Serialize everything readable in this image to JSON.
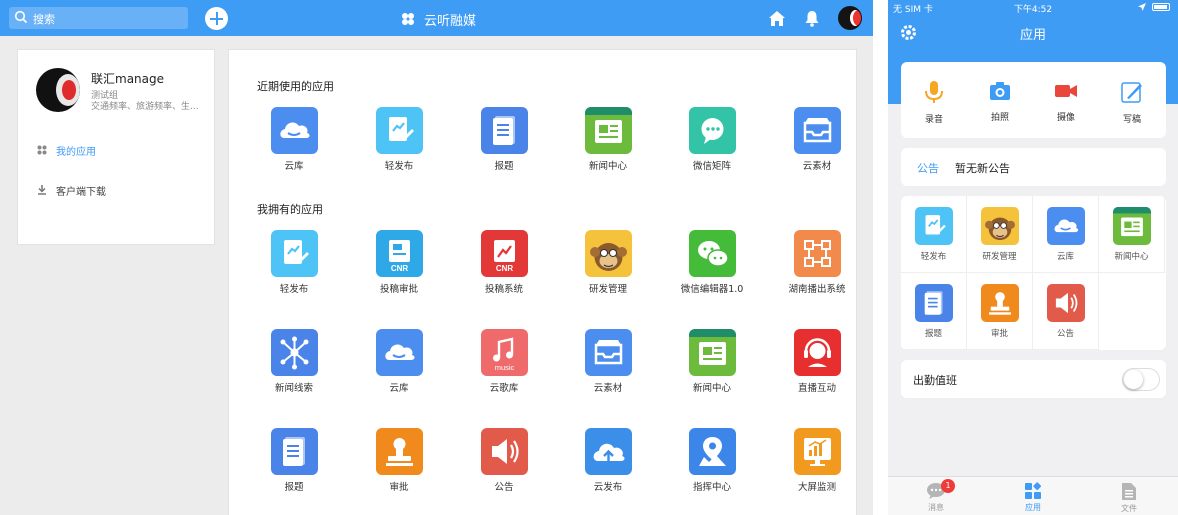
{
  "web": {
    "search_placeholder": "搜索",
    "brand_title": "云听融媒",
    "profile": {
      "name": "联汇manage",
      "group": "测试组",
      "description": "交通频率、旅游频率、生..."
    },
    "sidebar": [
      {
        "label": "我的应用",
        "icon": "apps-icon",
        "active": true
      },
      {
        "label": "客户端下载",
        "icon": "download-icon",
        "active": false
      }
    ],
    "recent_title": "近期使用的应用",
    "recent_apps": [
      {
        "label": "云库",
        "icon": "cloud-library-icon"
      },
      {
        "label": "轻发布",
        "icon": "quick-publish-icon"
      },
      {
        "label": "报题",
        "icon": "report-topic-icon"
      },
      {
        "label": "新闻中心",
        "icon": "news-center-icon"
      },
      {
        "label": "微信矩阵",
        "icon": "wechat-matrix-icon"
      },
      {
        "label": "云素材",
        "icon": "cloud-material-icon"
      }
    ],
    "owned_title": "我拥有的应用",
    "owned_apps": [
      {
        "label": "轻发布",
        "icon": "quick-publish-icon"
      },
      {
        "label": "投稿审批",
        "icon": "submission-review-icon",
        "badge": "CNR"
      },
      {
        "label": "投稿系统",
        "icon": "submission-system-icon",
        "badge": "CNR"
      },
      {
        "label": "研发管理",
        "icon": "rd-management-icon"
      },
      {
        "label": "微信编辑器1.0",
        "icon": "wechat-editor-icon"
      },
      {
        "label": "湖南播出系统",
        "icon": "broadcast-system-icon"
      },
      {
        "label": "新闻线索",
        "icon": "news-leads-icon"
      },
      {
        "label": "云库",
        "icon": "cloud-library-icon"
      },
      {
        "label": "云歌库",
        "icon": "cloud-music-icon",
        "badge": "music"
      },
      {
        "label": "云素材",
        "icon": "cloud-material-icon"
      },
      {
        "label": "新闻中心",
        "icon": "news-center-icon"
      },
      {
        "label": "直播互动",
        "icon": "live-interaction-icon"
      },
      {
        "label": "报题",
        "icon": "report-topic-icon"
      },
      {
        "label": "审批",
        "icon": "approval-icon"
      },
      {
        "label": "公告",
        "icon": "announcement-icon"
      },
      {
        "label": "云发布",
        "icon": "cloud-publish-icon"
      },
      {
        "label": "指挥中心",
        "icon": "command-center-icon"
      },
      {
        "label": "大屏监测",
        "icon": "screen-monitor-icon"
      }
    ]
  },
  "mobile": {
    "status": {
      "carrier": "无 SIM 卡",
      "time": "下午4:52"
    },
    "title": "应用",
    "quick_actions": [
      {
        "label": "录音",
        "icon": "microphone-icon"
      },
      {
        "label": "拍照",
        "icon": "camera-icon"
      },
      {
        "label": "摄像",
        "icon": "video-camera-icon"
      },
      {
        "label": "写稿",
        "icon": "pen-icon"
      }
    ],
    "notice_tag": "公告",
    "notice_text": "暂无新公告",
    "apps": [
      {
        "label": "轻发布",
        "icon": "quick-publish-icon"
      },
      {
        "label": "研发管理",
        "icon": "rd-management-icon"
      },
      {
        "label": "云库",
        "icon": "cloud-library-icon"
      },
      {
        "label": "新闻中心",
        "icon": "news-center-icon"
      },
      {
        "label": "报题",
        "icon": "report-topic-icon"
      },
      {
        "label": "审批",
        "icon": "approval-icon"
      },
      {
        "label": "公告",
        "icon": "announcement-icon"
      }
    ],
    "duty_label": "出勤值班",
    "duty_enabled": false,
    "tabs": [
      {
        "label": "消息",
        "icon": "message-icon",
        "badge": "1",
        "active": false
      },
      {
        "label": "应用",
        "icon": "apps-grid-icon",
        "active": true
      },
      {
        "label": "文件",
        "icon": "file-icon",
        "active": false
      }
    ]
  },
  "colors": {
    "primary": "#3f9cf5",
    "badge_red": "#f03b3b",
    "background": "#ececec"
  }
}
